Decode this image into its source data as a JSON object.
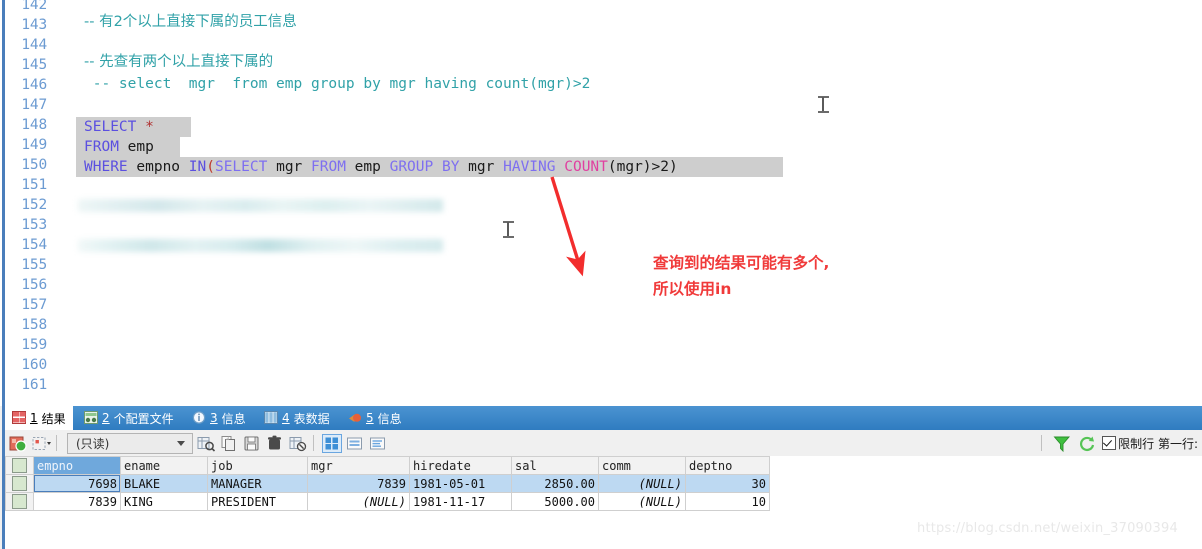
{
  "editor": {
    "first_line_number": 142,
    "last_line_number": 161,
    "lines": [
      {
        "n": 142,
        "text": ""
      },
      {
        "n": 143,
        "text": "-- 有2个以上直接下属的员工信息",
        "kind": "comment"
      },
      {
        "n": 144,
        "text": ""
      },
      {
        "n": 145,
        "text": "-- 先查有两个以上直接下属的",
        "kind": "comment"
      },
      {
        "n": 146,
        "text": " -- select  mgr  from emp group by mgr having count(mgr)>2",
        "kind": "comment"
      },
      {
        "n": 147,
        "text": ""
      },
      {
        "n": 148,
        "text": "SELECT *",
        "kind": "sql"
      },
      {
        "n": 149,
        "text": "FROM emp",
        "kind": "sql"
      },
      {
        "n": 150,
        "text": "WHERE empno IN(SELECT mgr FROM emp GROUP BY mgr HAVING COUNT(mgr)>2)",
        "kind": "sql"
      },
      {
        "n": 151,
        "text": ""
      },
      {
        "n": 152,
        "text": "",
        "kind": "redacted"
      },
      {
        "n": 153,
        "text": ""
      },
      {
        "n": 154,
        "text": "",
        "kind": "redacted"
      },
      {
        "n": 155,
        "text": ""
      },
      {
        "n": 156,
        "text": ""
      },
      {
        "n": 157,
        "text": ""
      },
      {
        "n": 158,
        "text": ""
      },
      {
        "n": 159,
        "text": ""
      },
      {
        "n": 160,
        "text": ""
      },
      {
        "n": 161,
        "text": ""
      }
    ],
    "sql_tokens": {
      "l148": [
        {
          "t": "SELECT",
          "c": "kw"
        },
        {
          "t": " ",
          "c": "id"
        },
        {
          "t": "*",
          "c": "star"
        }
      ],
      "l149": [
        {
          "t": "FROM",
          "c": "kw"
        },
        {
          "t": " emp",
          "c": "id"
        }
      ],
      "l150": [
        {
          "t": "WHERE",
          "c": "kw"
        },
        {
          "t": " empno ",
          "c": "id"
        },
        {
          "t": "IN",
          "c": "kw"
        },
        {
          "t": "(",
          "c": "punct-red"
        },
        {
          "t": "SELECT",
          "c": "kw2"
        },
        {
          "t": " mgr ",
          "c": "id"
        },
        {
          "t": "FROM",
          "c": "kw2"
        },
        {
          "t": " emp ",
          "c": "id"
        },
        {
          "t": "GROUP",
          "c": "kw2"
        },
        {
          "t": " ",
          "c": "id"
        },
        {
          "t": "BY",
          "c": "kw2"
        },
        {
          "t": " mgr ",
          "c": "id"
        },
        {
          "t": "HAVING",
          "c": "kw2"
        },
        {
          "t": " ",
          "c": "id"
        },
        {
          "t": "COUNT",
          "c": "fn"
        },
        {
          "t": "(mgr)>2)",
          "c": "id"
        }
      ]
    }
  },
  "annotation": {
    "line1": "查询到的结果可能有多个,",
    "line2": "所以使用in",
    "color": "#f03a3a",
    "arrow_name": "red-annotation-arrow"
  },
  "result_panel": {
    "tabs": [
      {
        "num": "1",
        "label": "结果",
        "icon": "grid-result-icon",
        "active": true
      },
      {
        "num": "2",
        "label": "个配置文件",
        "icon": "profile-icon",
        "active": false
      },
      {
        "num": "3",
        "label": "信息",
        "icon": "info-icon",
        "active": false
      },
      {
        "num": "4",
        "label": "表数据",
        "icon": "table-data-icon",
        "active": false
      },
      {
        "num": "5",
        "label": "信息",
        "icon": "status-icon",
        "active": false
      }
    ],
    "toolbar": {
      "icons_left": [
        "apply-changes-icon",
        "grid-options-dropdown-icon"
      ],
      "mode_value": "(只读)",
      "icons_mid": [
        "search-record-icon",
        "duplicate-record-icon",
        "save-record-icon",
        "delete-record-icon",
        "refresh-record-icon"
      ],
      "view_icons": [
        "grid-view-icon",
        "form-view-icon",
        "text-view-icon"
      ],
      "icons_right": [
        "filter-icon",
        "refresh-icon"
      ],
      "limit_checkbox_checked": true,
      "limit_label": "限制行",
      "first_row_label": "第一行:"
    },
    "grid": {
      "columns": [
        "empno",
        "ename",
        "job",
        "mgr",
        "hiredate",
        "sal",
        "comm",
        "deptno"
      ],
      "selected_column": "empno",
      "rows": [
        {
          "selected": true,
          "cells": [
            "7698",
            "BLAKE",
            "MANAGER",
            "7839",
            "1981-05-01",
            "2850.00",
            "(NULL)",
            "30"
          ]
        },
        {
          "selected": false,
          "cells": [
            "7839",
            "KING",
            "PRESIDENT",
            "(NULL)",
            "1981-11-17",
            "5000.00",
            "(NULL)",
            "10"
          ]
        }
      ]
    }
  },
  "watermark": {
    "text": "https://blog.csdn.net/weixin_37090394"
  },
  "colors": {
    "tab_strip": "#3c87c8",
    "gutter_text": "#6c9bd2",
    "comment": "#31a2a8",
    "keyword": "#5b4fe0",
    "selection": "#cecece",
    "row_selected": "#bdd9f2",
    "annotation_red": "#f03a3a"
  }
}
